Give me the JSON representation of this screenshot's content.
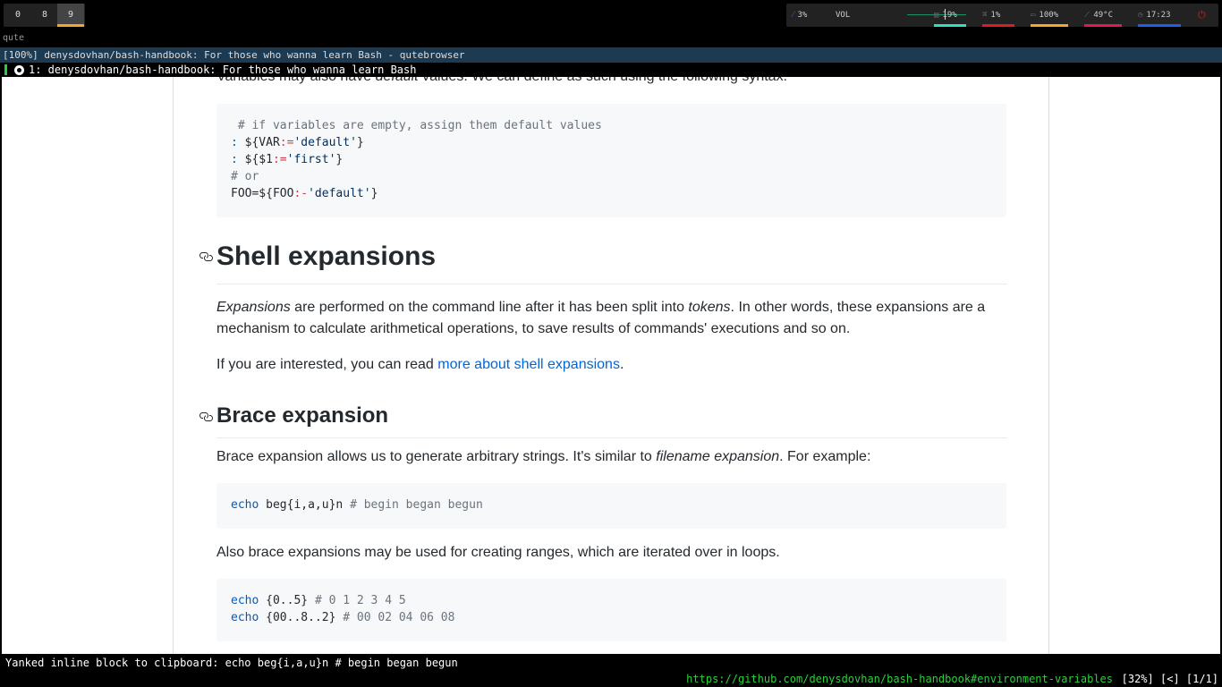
{
  "workspaces": [
    {
      "label": "0"
    },
    {
      "label": "8"
    },
    {
      "label": "9",
      "active": true
    }
  ],
  "status": {
    "cpu": "3%",
    "vol_label": "VOL",
    "mem": "19%",
    "swap": "1%",
    "battery": "100%",
    "temp": "49°C",
    "clock": "17:23",
    "colors": {
      "mem": "#2ee0c0",
      "swap": "#e01b24",
      "battery": "#f5a52a",
      "temp": "#e01b4c",
      "clock": "#1f5ff0",
      "power": "#e01b24"
    }
  },
  "browser": {
    "cmdline": "qute",
    "title": "[100%] denysdovhan/bash-handbook: For those who wanna learn Bash - qutebrowser",
    "tab_label": "1: denysdovhan/bash-handbook: For those who wanna learn Bash"
  },
  "article": {
    "intro_before": "Variables may also have ",
    "intro_em": "default",
    "intro_after": " values. We can define as such using the following syntax:",
    "code1": {
      "line1": " # if variables are empty, assign them default values",
      "line2_op": ":",
      "line2_a": " ${VAR",
      "line2_assign": ":=",
      "line2_str": "'default'",
      "line2_end": "}",
      "line3_op": ":",
      "line3_a": " ${$1",
      "line3_assign": ":=",
      "line3_str": "'first'",
      "line3_end": "}",
      "line4": "# or",
      "line5_a": "FOO=${FOO",
      "line5_assign": ":-",
      "line5_str": "'default'",
      "line5_end": "}"
    },
    "h_shell": "Shell expansions",
    "p_exp_em1": "Expansions",
    "p_exp_mid": " are performed on the command line after it has been split into ",
    "p_exp_em2": "tokens",
    "p_exp_end": ". In other words, these expansions are a mechanism to calculate arithmetical operations, to save results of commands' executions and so on.",
    "p_interest_before": "If you are interested, you can read ",
    "p_interest_link": "more about shell expansions",
    "p_interest_after": ".",
    "h_brace": "Brace expansion",
    "p_brace_before": "Brace expansion allows us to generate arbitrary strings. It's similar to ",
    "p_brace_em": "filename expansion",
    "p_brace_after": ". For example:",
    "code2": {
      "kw": "echo",
      "body": " beg{i,a,u}n ",
      "comment": "# begin began begun"
    },
    "p_ranges": "Also brace expansions may be used for creating ranges, which are iterated over in loops.",
    "code3": {
      "l1_kw": "echo",
      "l1_body": " {0..5} ",
      "l1_comment": "# 0 1 2 3 4 5",
      "l2_kw": "echo",
      "l2_body": " {00..8..2} ",
      "l2_comment": "# 00 02 04 06 08"
    }
  },
  "message": "Yanked inline block to clipboard: echo beg{i,a,u}n # begin began begun",
  "statusbar": {
    "url": "https://github.com/denysdovhan/bash-handbook#environment-variables",
    "right": "[32%] [<] [1/1]"
  }
}
